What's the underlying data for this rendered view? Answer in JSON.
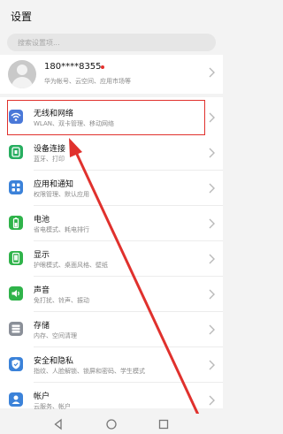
{
  "header": {
    "title": "设置"
  },
  "search": {
    "placeholder": "搜索设置项..."
  },
  "account": {
    "name": "180****8355",
    "subtitle": "华为帐号、云空间、应用市场等",
    "has_notification_dot": true
  },
  "colors": {
    "highlight": "#e0312d",
    "arrow": "#e0312d",
    "wlan_icon": "#4a78d8",
    "device_icon": "#27ae60",
    "apps_icon": "#3b82d9",
    "battery_icon": "#2fb34a",
    "display_icon": "#2fb34a",
    "sound_icon": "#2fb34a",
    "storage_icon": "#8a8f98",
    "security_icon": "#3b82d9",
    "accounts_icon": "#3b82d9"
  },
  "settings": [
    {
      "title": "无线和网络",
      "subtitle": "WLAN、双卡管理、移动网络",
      "icon": "wifi-icon"
    },
    {
      "title": "设备连接",
      "subtitle": "蓝牙、打印",
      "icon": "device-connection-icon"
    },
    {
      "title": "应用和通知",
      "subtitle": "权限管理、默认应用",
      "icon": "apps-icon"
    },
    {
      "title": "电池",
      "subtitle": "省电模式、耗电排行",
      "icon": "battery-icon"
    },
    {
      "title": "显示",
      "subtitle": "护眼模式、桌面风格、壁纸",
      "icon": "display-icon"
    },
    {
      "title": "声音",
      "subtitle": "免打扰、铃声、振动",
      "icon": "sound-icon"
    },
    {
      "title": "存储",
      "subtitle": "内存、空间清理",
      "icon": "storage-icon"
    },
    {
      "title": "安全和隐私",
      "subtitle": "指纹、人脸解锁、锁屏和密码、学生模式",
      "icon": "security-icon"
    },
    {
      "title": "帐户",
      "subtitle": "云服务、帐户",
      "icon": "account-icon"
    }
  ],
  "navbar": {
    "buttons": [
      "back-icon",
      "home-icon",
      "recents-icon"
    ]
  }
}
